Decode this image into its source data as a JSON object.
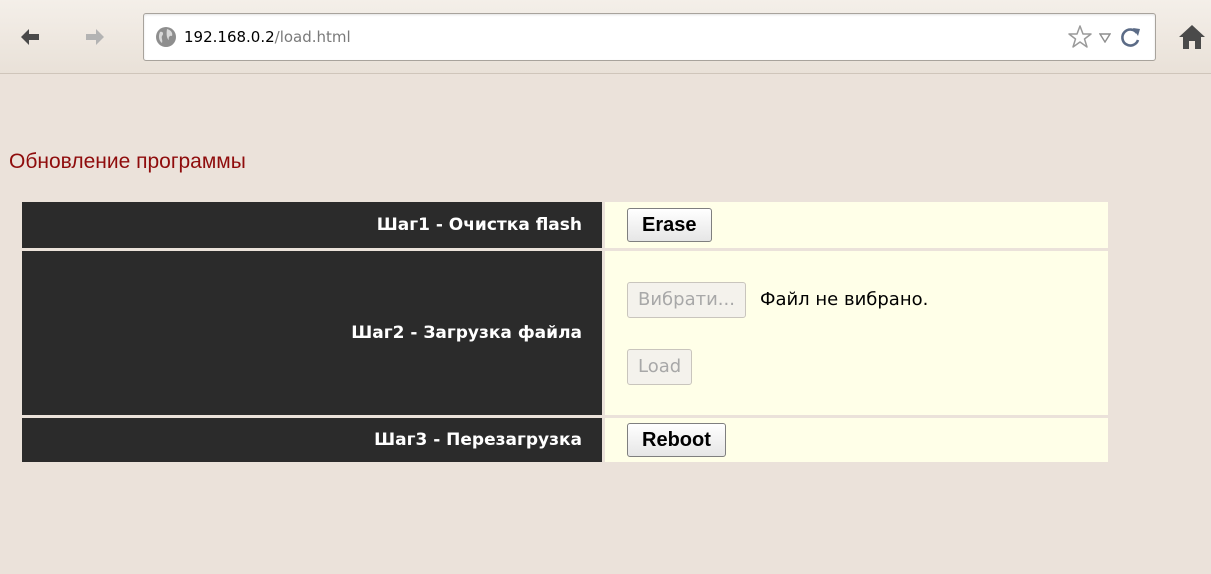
{
  "browser": {
    "url_host": "192.168.0.2",
    "url_path": "/load.html",
    "icons": [
      "back-arrow-icon",
      "forward-arrow-icon",
      "globe-icon",
      "bookmark-star-icon",
      "dropdown-icon",
      "reload-icon",
      "home-icon"
    ]
  },
  "page": {
    "title": "Обновление программы"
  },
  "steps": [
    {
      "label": "Шаг1 - Очистка flash",
      "button_label": "Erase"
    },
    {
      "label": "Шаг2 - Загрузка файла",
      "file_button_label": "Вибрати...",
      "file_status": "Файл не вибрано.",
      "load_label": "Load"
    },
    {
      "label": "Шаг3 - Перезагрузка",
      "button_label": "Reboot"
    }
  ],
  "colors": {
    "page_background": "#ebe2da",
    "title": "#8f0c0c",
    "label_cell": "#2b2b2b",
    "action_cell": "#ffffe8"
  }
}
